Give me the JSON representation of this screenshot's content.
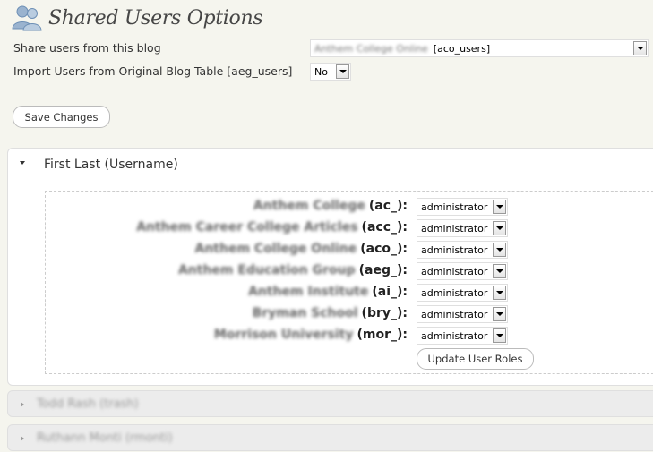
{
  "header": {
    "title": "Shared Users Options",
    "icon": "users-icon"
  },
  "options": {
    "share_label": "Share users from this blog",
    "share_value_blurred": "Anthem College Online",
    "share_value_suffix": "[aco_users]",
    "import_label": "Import Users from Original Blog Table [aeg_users]",
    "import_value": "No"
  },
  "save_button": "Save Changes",
  "user_panel": {
    "title": "First Last (Username)",
    "roles": [
      {
        "blog": "Anthem College",
        "prefix": "(ac_):",
        "role": "administrator"
      },
      {
        "blog": "Anthem Career College Articles",
        "prefix": "(acc_):",
        "role": "administrator"
      },
      {
        "blog": "Anthem College Online",
        "prefix": "(aco_):",
        "role": "administrator"
      },
      {
        "blog": "Anthem Education Group",
        "prefix": "(aeg_):",
        "role": "administrator"
      },
      {
        "blog": "Anthem Institute",
        "prefix": "(ai_):",
        "role": "administrator"
      },
      {
        "blog": "Bryman School",
        "prefix": "(bry_):",
        "role": "administrator"
      },
      {
        "blog": "Morrison University",
        "prefix": "(mor_):",
        "role": "administrator"
      }
    ],
    "update_button": "Update User Roles"
  },
  "collapsed_users": [
    {
      "label": "Todd Rash (trash)"
    },
    {
      "label": "Ruthann Monti (rmonti)"
    }
  ]
}
